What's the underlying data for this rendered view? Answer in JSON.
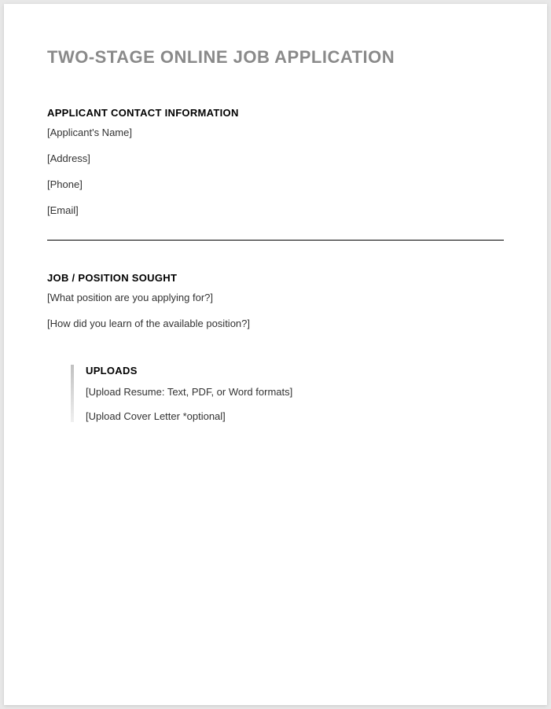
{
  "title": "TWO-STAGE ONLINE JOB APPLICATION",
  "sections": {
    "contact": {
      "heading": "APPLICANT CONTACT INFORMATION",
      "fields": {
        "name": "[Applicant's Name]",
        "address": "[Address]",
        "phone": "[Phone]",
        "email": "[Email]"
      }
    },
    "position": {
      "heading": "JOB / POSITION SOUGHT",
      "fields": {
        "applying_for": "[What position are you applying for?]",
        "learned_from": "[How did you learn of the available position?]"
      }
    },
    "uploads": {
      "heading": "UPLOADS",
      "fields": {
        "resume": "[Upload Resume: Text, PDF, or Word formats]",
        "cover_letter": "[Upload Cover Letter *optional]"
      }
    }
  }
}
